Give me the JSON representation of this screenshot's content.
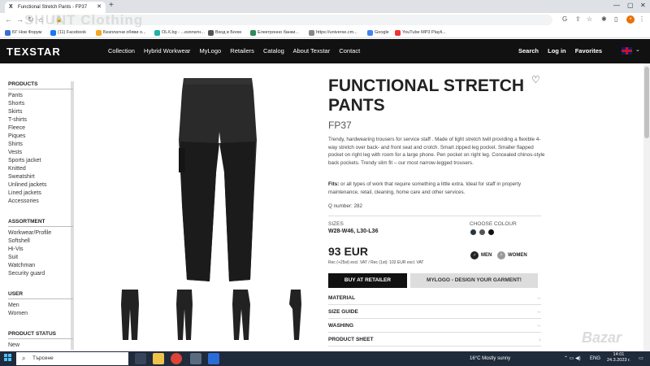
{
  "browser": {
    "tab_title": "Functional Stretch Pants - FP37",
    "tab_favicon": "X",
    "url": "",
    "bookmarks": [
      {
        "label": "БГ Нов Форум",
        "color": "#3b6fd4"
      },
      {
        "label": "(11) Facebook",
        "color": "#1877f2"
      },
      {
        "label": "Безплатни обяви о...",
        "color": "#f5a623"
      },
      {
        "label": "OLX.bg - ...езплатн...",
        "color": "#23b0a8"
      },
      {
        "label": "Вход в Боом",
        "color": "#555555"
      },
      {
        "label": "Електронно банки...",
        "color": "#2e8b57"
      },
      {
        "label": "https://universe.cm...",
        "color": "#888888"
      },
      {
        "label": "Google",
        "color": "#4285f4"
      },
      {
        "label": "YouTube MP3 Playli...",
        "color": "#e33"
      }
    ]
  },
  "header": {
    "logo": "TEXSTAR",
    "nav": [
      "Collection",
      "Hybrid Workwear",
      "MyLogo",
      "Retailers",
      "Catalog",
      "About Texstar",
      "Contact"
    ],
    "right_nav": [
      "Search",
      "Log in",
      "Favorites"
    ]
  },
  "watermark": "SHUNT Clothing",
  "sidebar": {
    "sections": [
      {
        "title": "PRODUCTS",
        "items": [
          "Pants",
          "Shorts",
          "Skirts",
          "T-shirts",
          "Fleece",
          "Piques",
          "Shirts",
          "Vests",
          "Sports jacket",
          "Knitted",
          "Sweatshirt",
          "Unlined jackets",
          "Lined jackets",
          "Accessories"
        ]
      },
      {
        "title": "ASSORTMENT",
        "items": [
          "Workwear/Profile",
          "Softshell",
          "Hi-Vis",
          "Suit",
          "Watchman",
          "Security guard"
        ]
      },
      {
        "title": "USER",
        "items": [
          "Men",
          "Women"
        ]
      },
      {
        "title": "PRODUCT STATUS",
        "items": [
          "New"
        ]
      }
    ]
  },
  "product": {
    "title": "FUNCTIONAL STRETCH PANTS",
    "code": "FP37",
    "description": "Trendy, hardwearing trousers for service staff . Made of light stretch twill providing a flexible 4-way stretch over back- and front seat and crotch. Smart zipped leg pocket. Smaller flapped pocket on right leg with room for a large phone. Pen pocket on right leg. Concealed chinos-style back pockets. Trendy slim fit – our most narrow-legged trousers.",
    "fits_label": "Fits:",
    "fits_text": " or all types of work that require something a little extra. Ideal for staff in property maintenance, retail, cleaning, home care and other services.",
    "q_number": "Q number: 282",
    "sizes_label": "SIZES",
    "sizes_value": "W28-W46, L30-L36",
    "colour_label": "CHOOSE COLOUR",
    "colours": [
      "#2b3445",
      "#555555",
      "#111111"
    ],
    "price": "93 EUR",
    "price_info": "Rec (+25st) excl. VAT / Rec (1st): 102 EUR excl. VAT",
    "gender_men": "MEN",
    "gender_women": "WOMEN",
    "buy_button": "BUY AT RETAILER",
    "mylogo_button": "MYLOGO - DESIGN YOUR GARMENT!",
    "accordion": [
      "MATERIAL",
      "SIZE GUIDE",
      "WASHING",
      "PRODUCT SHEET"
    ]
  },
  "bazar_mark": "Bazar",
  "taskbar": {
    "search_placeholder": "Търсене",
    "weather": "16°C  Mostly sunny",
    "lang": "ENG",
    "time": "14:01",
    "date": "24.3.2023 г."
  }
}
